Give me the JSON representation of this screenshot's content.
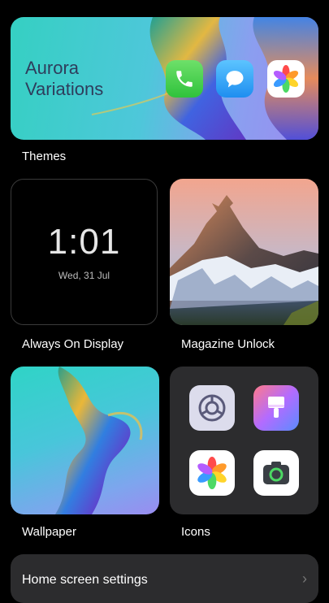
{
  "themes": {
    "title_line1": "Aurora",
    "title_line2": "Variations",
    "label": "Themes",
    "apps": [
      "phone-icon",
      "messages-icon",
      "photos-icon"
    ]
  },
  "always_on_display": {
    "time": "1:01",
    "date": "Wed, 31 Jul",
    "label": "Always On Display"
  },
  "magazine_unlock": {
    "label": "Magazine Unlock"
  },
  "wallpaper": {
    "label": "Wallpaper"
  },
  "icons": {
    "label": "Icons",
    "tiles": [
      "settings-icon",
      "themes-brush-icon",
      "photos-icon",
      "camera-icon"
    ]
  },
  "home_screen_settings": {
    "label": "Home screen settings"
  },
  "colors": {
    "background": "#000000",
    "card_dark": "#2c2c2e",
    "aurora_teal": "#35d0c2",
    "aurora_purple": "#9c8bf0"
  }
}
